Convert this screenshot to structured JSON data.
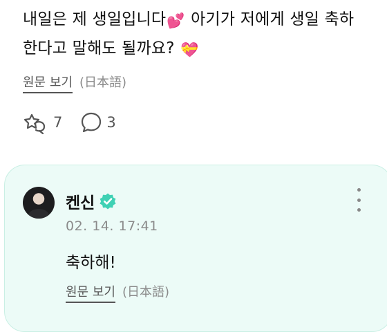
{
  "post": {
    "text_part1": "내일은 제 생일입니다",
    "emoji_hearts": "💕",
    "text_part2": " 아기가 저에게 생일 축하한다고 말해도 될까요?",
    "emoji_gift_heart": "💝",
    "original_link": "원문 보기",
    "original_lang": "(日本語)"
  },
  "actions": {
    "reaction_count": "7",
    "comment_count": "3"
  },
  "reply": {
    "author": "켄신",
    "timestamp": "02. 14. 17:41",
    "text": "축하해!",
    "original_link": "원문 보기",
    "original_lang": "(日本語)"
  },
  "colors": {
    "card_background": "#ecfbf7",
    "verified_badge": "#3fd1b4",
    "muted_text": "#8a8a8a"
  }
}
